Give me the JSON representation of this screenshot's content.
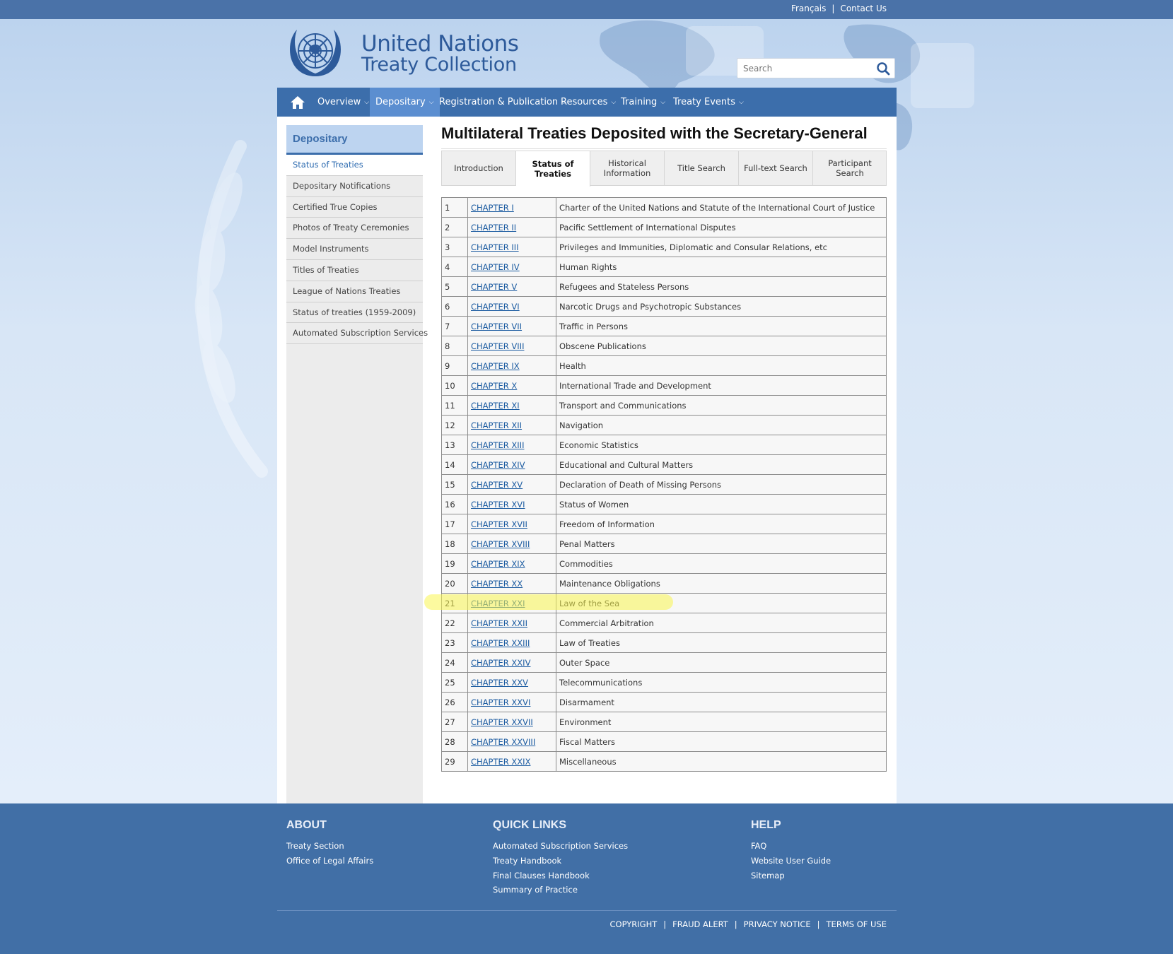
{
  "top_links": {
    "francais": "Français",
    "separator": "|",
    "contact": "Contact Us"
  },
  "brand": {
    "line1": "United Nations",
    "line2": "Treaty Collection"
  },
  "search": {
    "placeholder": "Search"
  },
  "nav": {
    "items": [
      {
        "label": "Overview"
      },
      {
        "label": "Depositary"
      },
      {
        "label": "Registration & Publication"
      },
      {
        "label": "Resources"
      },
      {
        "label": "Training"
      },
      {
        "label": "Treaty Events"
      }
    ],
    "active": "Depositary"
  },
  "sidebar": {
    "heading": "Depositary",
    "items": [
      {
        "label": "Status of Treaties"
      },
      {
        "label": "Depositary Notifications"
      },
      {
        "label": "Certified True Copies"
      },
      {
        "label": "Photos of Treaty Ceremonies"
      },
      {
        "label": "Model Instruments"
      },
      {
        "label": "Titles of Treaties"
      },
      {
        "label": "League of Nations Treaties"
      },
      {
        "label": "Status of treaties (1959-2009)"
      },
      {
        "label": "Automated Subscription Services"
      }
    ]
  },
  "main": {
    "title": "Multilateral Treaties Deposited with the Secretary-General",
    "tabs": [
      {
        "label": "Introduction"
      },
      {
        "label": "Status of Treaties"
      },
      {
        "label": "Historical Information"
      },
      {
        "label": "Title Search"
      },
      {
        "label": "Full-text Search"
      },
      {
        "label": "Participant Search"
      }
    ],
    "active_tab": "Status of Treaties",
    "chapters": [
      {
        "num": "1",
        "chapter": "CHAPTER I",
        "title": "Charter of the United Nations and Statute of the International Court of Justice"
      },
      {
        "num": "2",
        "chapter": "CHAPTER II",
        "title": "Pacific Settlement of International Disputes"
      },
      {
        "num": "3",
        "chapter": "CHAPTER III",
        "title": "Privileges and Immunities, Diplomatic and Consular Relations, etc"
      },
      {
        "num": "4",
        "chapter": "CHAPTER IV",
        "title": "Human Rights"
      },
      {
        "num": "5",
        "chapter": "CHAPTER V",
        "title": "Refugees and Stateless Persons"
      },
      {
        "num": "6",
        "chapter": "CHAPTER VI",
        "title": "Narcotic Drugs and Psychotropic Substances"
      },
      {
        "num": "7",
        "chapter": "CHAPTER VII",
        "title": "Traffic in Persons"
      },
      {
        "num": "8",
        "chapter": "CHAPTER VIII",
        "title": "Obscene Publications"
      },
      {
        "num": "9",
        "chapter": "CHAPTER IX",
        "title": "Health"
      },
      {
        "num": "10",
        "chapter": "CHAPTER X",
        "title": "International Trade and Development"
      },
      {
        "num": "11",
        "chapter": "CHAPTER XI",
        "title": "Transport and Communications"
      },
      {
        "num": "12",
        "chapter": "CHAPTER XII",
        "title": "Navigation"
      },
      {
        "num": "13",
        "chapter": "CHAPTER XIII",
        "title": "Economic Statistics"
      },
      {
        "num": "14",
        "chapter": "CHAPTER XIV",
        "title": "Educational and Cultural Matters"
      },
      {
        "num": "15",
        "chapter": "CHAPTER XV",
        "title": "Declaration of Death of Missing Persons"
      },
      {
        "num": "16",
        "chapter": "CHAPTER XVI",
        "title": "Status of Women"
      },
      {
        "num": "17",
        "chapter": "CHAPTER XVII",
        "title": "Freedom of Information"
      },
      {
        "num": "18",
        "chapter": "CHAPTER XVIII",
        "title": "Penal Matters"
      },
      {
        "num": "19",
        "chapter": "CHAPTER XIX",
        "title": "Commodities"
      },
      {
        "num": "20",
        "chapter": "CHAPTER XX",
        "title": "Maintenance Obligations"
      },
      {
        "num": "21",
        "chapter": "CHAPTER XXI",
        "title": "Law of the Sea"
      },
      {
        "num": "22",
        "chapter": "CHAPTER XXII",
        "title": "Commercial Arbitration"
      },
      {
        "num": "23",
        "chapter": "CHAPTER XXIII",
        "title": "Law of Treaties"
      },
      {
        "num": "24",
        "chapter": "CHAPTER XXIV",
        "title": "Outer Space"
      },
      {
        "num": "25",
        "chapter": "CHAPTER XXV",
        "title": "Telecommunications"
      },
      {
        "num": "26",
        "chapter": "CHAPTER XXVI",
        "title": "Disarmament"
      },
      {
        "num": "27",
        "chapter": "CHAPTER XXVII",
        "title": "Environment"
      },
      {
        "num": "28",
        "chapter": "CHAPTER XXVIII",
        "title": "Fiscal Matters"
      },
      {
        "num": "29",
        "chapter": "CHAPTER XXIX",
        "title": "Miscellaneous"
      }
    ],
    "highlighted_row": "21"
  },
  "footer": {
    "about": {
      "heading": "ABOUT",
      "links": [
        "Treaty Section",
        "Office of Legal Affairs"
      ]
    },
    "quick_links": {
      "heading": "QUICK LINKS",
      "links": [
        "Automated Subscription Services",
        "Treaty Handbook",
        "Final Clauses Handbook",
        "Summary of Practice"
      ]
    },
    "help": {
      "heading": "HELP",
      "links": [
        "FAQ",
        "Website User Guide",
        "Sitemap"
      ]
    },
    "bottom_links": [
      "COPYRIGHT",
      "FRAUD ALERT",
      "PRIVACY NOTICE",
      "TERMS OF USE"
    ],
    "bottom_separator": "|"
  },
  "colors": {
    "nav_bg": "#3c6eab",
    "nav_active": "#5b8ed0",
    "footer_bg": "#416fa6",
    "link": "#1a5aa0",
    "highlight": "#faf550"
  },
  "icons": {
    "home": "home-icon",
    "search": "search-icon",
    "logo": "un-emblem-icon"
  }
}
